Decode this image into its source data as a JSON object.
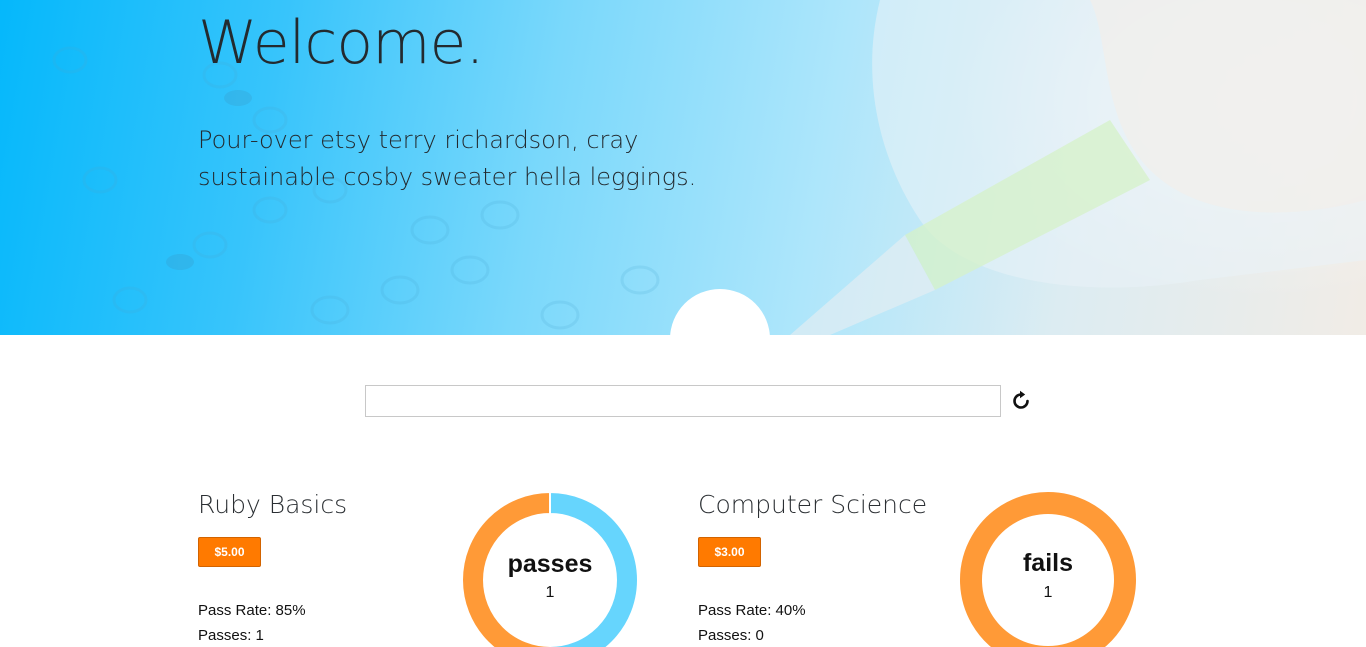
{
  "hero": {
    "title": "Welcome.",
    "subtitle": "Pour-over etsy terry richardson, cray sustainable cosby sweater hella leggings."
  },
  "search": {
    "value": "",
    "placeholder": "",
    "refresh_icon": "refresh-icon"
  },
  "colors": {
    "accent_orange": "#ff7a00",
    "chart_orange": "#ff9a37",
    "chart_blue": "#66d5fd",
    "hero_blue": "#05b8fb"
  },
  "courses": [
    {
      "title": "Ruby Basics",
      "price": "$5.00",
      "pass_rate": "Pass Rate: 85%",
      "passes": "Passes: 1",
      "chart_label": "passes",
      "chart_count": "1"
    },
    {
      "title": "Computer Science",
      "price": "$3.00",
      "pass_rate": "Pass Rate: 40%",
      "passes": "Passes: 0",
      "chart_label": "fails",
      "chart_count": "1"
    }
  ],
  "chart_data": [
    {
      "type": "pie",
      "categories": [
        "passes",
        "fails"
      ],
      "values": [
        1,
        1
      ],
      "colors": [
        "#66d5fd",
        "#ff9a37"
      ]
    },
    {
      "type": "pie",
      "categories": [
        "passes",
        "fails"
      ],
      "values": [
        0,
        1
      ],
      "colors": [
        "#66d5fd",
        "#ff9a37"
      ]
    }
  ]
}
